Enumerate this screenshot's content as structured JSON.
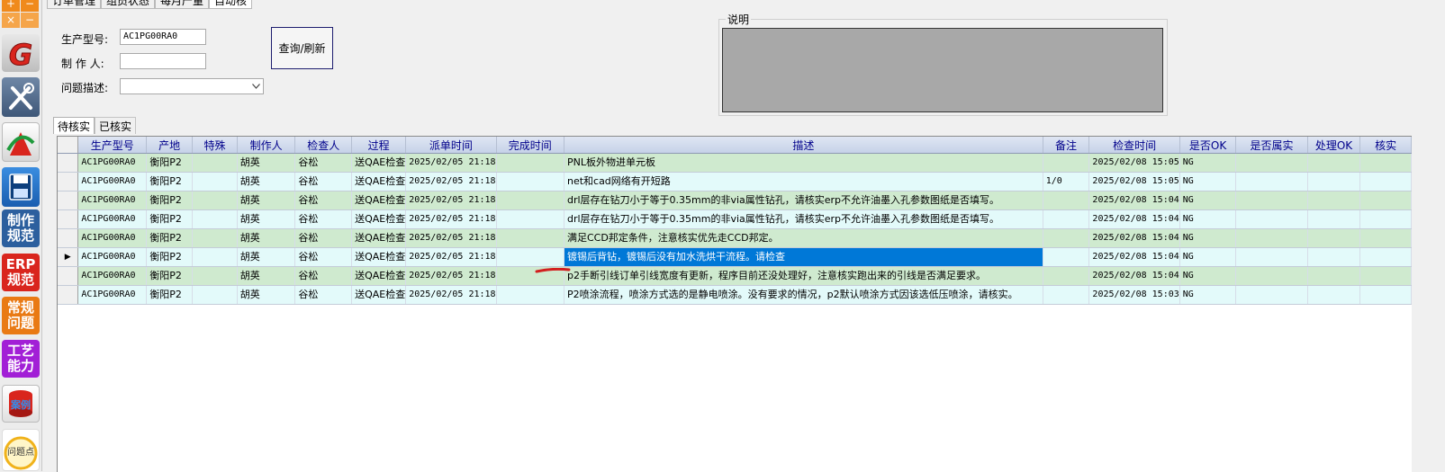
{
  "sidebar": {
    "top_plus": "+",
    "top_minus": "−",
    "top_x": "×",
    "top_dash": "−",
    "btn_zhizuo": "制作\n规范",
    "btn_erp": "ERP\n规范",
    "btn_changgui": "常规\n问题",
    "btn_gongyi": "工艺\n能力",
    "btn_anli": "案例",
    "btn_wentidian": "问题点",
    "colors": {
      "red": "#d9251d",
      "blue": "#2c5f9e",
      "orange": "#e97a14",
      "purple": "#a21fd6"
    }
  },
  "tabs": [
    "订单管理",
    "组员状态",
    "每月产量",
    "自动核"
  ],
  "form": {
    "model_label": "生产型号:",
    "model_value": "AC1PG00RA0",
    "maker_label": "制 作 人:",
    "maker_value": "",
    "issue_label": "问题描述:",
    "issue_value": "",
    "query_button": "查询/刷新"
  },
  "description": {
    "legend": "说明"
  },
  "sub_tabs": [
    "待核实",
    "已核实"
  ],
  "grid": {
    "columns": [
      "生产型号",
      "产地",
      "特殊",
      "制作人",
      "检查人",
      "过程",
      "派单时间",
      "完成时间",
      "描述",
      "备注",
      "检查时间",
      "是否OK",
      "是否属实",
      "处理OK",
      "核实"
    ],
    "selected_row": 5,
    "rows": [
      {
        "model": "AC1PG00RA0",
        "site": "衡阳P2",
        "special": "",
        "maker": "胡英",
        "checker": "谷松",
        "process": "送QAE检查",
        "dispatch": "2025/02/05 21:18",
        "done": "",
        "desc": "PNL板外物进单元板",
        "note": "",
        "check_time": "2025/02/08 15:05",
        "ok": "NG"
      },
      {
        "model": "AC1PG00RA0",
        "site": "衡阳P2",
        "special": "",
        "maker": "胡英",
        "checker": "谷松",
        "process": "送QAE检查",
        "dispatch": "2025/02/05 21:18",
        "done": "",
        "desc": "net和cad网络有开短路",
        "note": "1/0",
        "check_time": "2025/02/08 15:05",
        "ok": "NG"
      },
      {
        "model": "AC1PG00RA0",
        "site": "衡阳P2",
        "special": "",
        "maker": "胡英",
        "checker": "谷松",
        "process": "送QAE检查",
        "dispatch": "2025/02/05 21:18",
        "done": "",
        "desc": "drl层存在钻刀小于等于0.35mm的非via属性钻孔，请核实erp不允许油墨入孔参数图纸是否填写。",
        "note": "",
        "check_time": "2025/02/08 15:04",
        "ok": "NG"
      },
      {
        "model": "AC1PG00RA0",
        "site": "衡阳P2",
        "special": "",
        "maker": "胡英",
        "checker": "谷松",
        "process": "送QAE检查",
        "dispatch": "2025/02/05 21:18",
        "done": "",
        "desc": "drl层存在钻刀小于等于0.35mm的非via属性钻孔，请核实erp不允许油墨入孔参数图纸是否填写。",
        "note": "",
        "check_time": "2025/02/08 15:04",
        "ok": "NG"
      },
      {
        "model": "AC1PG00RA0",
        "site": "衡阳P2",
        "special": "",
        "maker": "胡英",
        "checker": "谷松",
        "process": "送QAE检查",
        "dispatch": "2025/02/05 21:18",
        "done": "",
        "desc": "满足CCD邦定条件，注意核实优先走CCD邦定。",
        "note": "",
        "check_time": "2025/02/08 15:04",
        "ok": "NG"
      },
      {
        "model": "AC1PG00RA0",
        "site": "衡阳P2",
        "special": "",
        "maker": "胡英",
        "checker": "谷松",
        "process": "送QAE检查",
        "dispatch": "2025/02/05 21:18",
        "done": "",
        "desc": "镀锡后背钻，镀锡后没有加水洗烘干流程。请检查",
        "note": "",
        "check_time": "2025/02/08 15:04",
        "ok": "NG"
      },
      {
        "model": "AC1PG00RA0",
        "site": "衡阳P2",
        "special": "",
        "maker": "胡英",
        "checker": "谷松",
        "process": "送QAE检查",
        "dispatch": "2025/02/05 21:18",
        "done": "",
        "desc": "p2手断引线订单引线宽度有更新，程序目前还没处理好，注意核实跑出来的引线是否满足要求。",
        "note": "",
        "check_time": "2025/02/08 15:04",
        "ok": "NG"
      },
      {
        "model": "AC1PG00RA0",
        "site": "衡阳P2",
        "special": "",
        "maker": "胡英",
        "checker": "谷松",
        "process": "送QAE检查",
        "dispatch": "2025/02/05 21:18",
        "done": "",
        "desc": "P2喷涂流程，喷涂方式选的是静电喷涂。没有要求的情况，p2默认喷涂方式因该选低压喷涂，请核实。",
        "note": "",
        "check_time": "2025/02/08 15:03",
        "ok": "NG"
      }
    ]
  }
}
